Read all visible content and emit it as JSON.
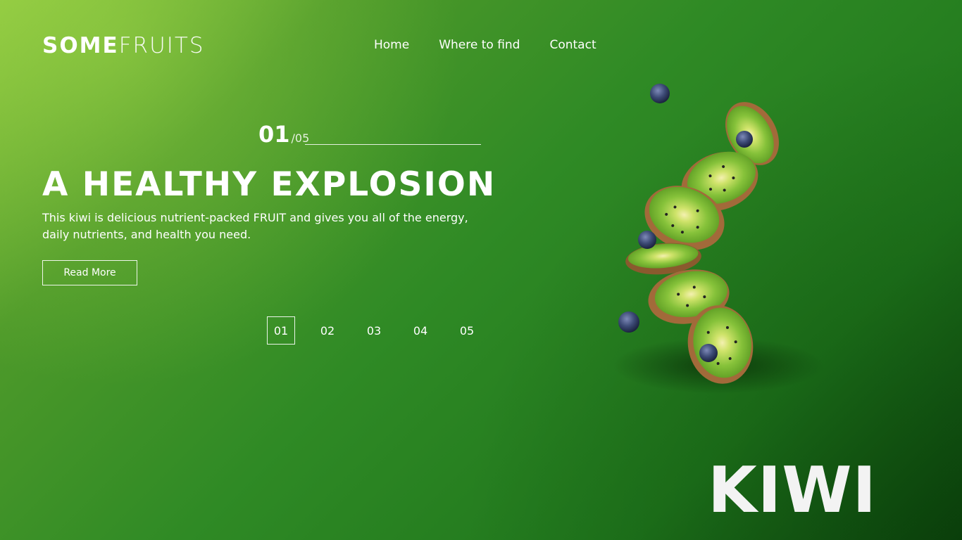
{
  "brand": {
    "bold": "SOME",
    "light": "FRUITS"
  },
  "nav": {
    "items": [
      "Home",
      "Where to find",
      "Contact"
    ]
  },
  "slide": {
    "current": "01",
    "total": "/05",
    "headline": "A HEALTHY EXPLOSION",
    "description": "This kiwi is delicious nutrient-packed FRUIT and gives you all of the energy, daily nutrients, and health you need.",
    "cta": "Read More",
    "fruit_name": "KIWI"
  },
  "pagination": {
    "pages": [
      "01",
      "02",
      "03",
      "04",
      "05"
    ],
    "active": "01"
  },
  "illustration": {
    "subject": "kiwi-slices-with-blueberries",
    "colors": {
      "kiwi_flesh": "#86c23a",
      "kiwi_skin": "#a26a3a",
      "kiwi_core": "#f4f0b0",
      "blueberry": "#3c4a75"
    }
  }
}
